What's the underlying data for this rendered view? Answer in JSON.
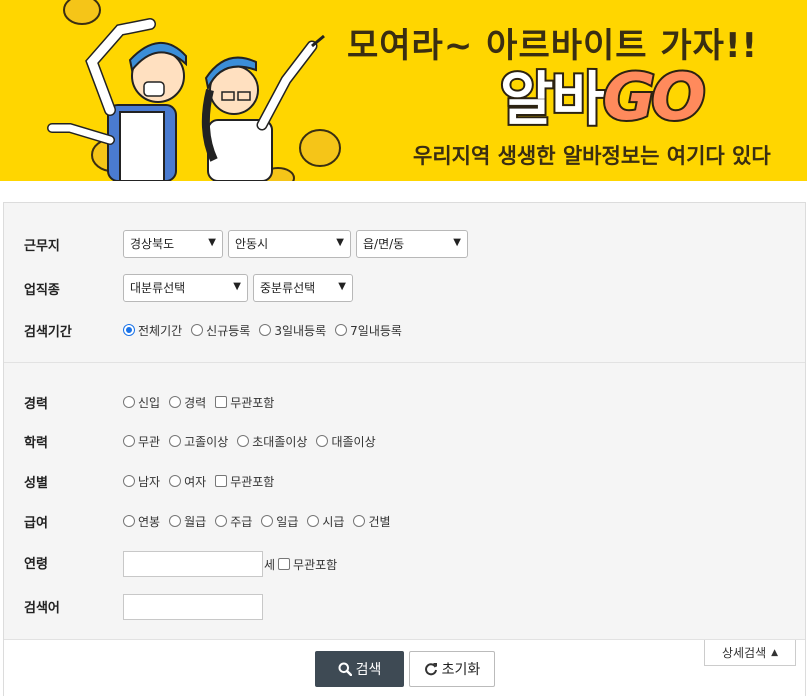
{
  "banner": {
    "title": "모여라~ 아르바이트 가자!!",
    "logo_korean": "알바",
    "logo_go": "GO",
    "subtitle": "우리지역 생생한 알바정보는 여기다 있다"
  },
  "form": {
    "location": {
      "label": "근무지",
      "province": "경상북도",
      "city": "안동시",
      "town": "읍/면/동"
    },
    "job_type": {
      "label": "업직종",
      "major": "대분류선택",
      "minor": "중분류선택"
    },
    "period": {
      "label": "검색기간",
      "options": [
        "전체기간",
        "신규등록",
        "3일내등록",
        "7일내등록"
      ],
      "selected": "전체기간"
    },
    "career": {
      "label": "경력",
      "options": [
        "신입",
        "경력"
      ],
      "any_label": "무관포함"
    },
    "education": {
      "label": "학력",
      "options": [
        "무관",
        "고졸이상",
        "초대졸이상",
        "대졸이상"
      ]
    },
    "gender": {
      "label": "성별",
      "options": [
        "남자",
        "여자"
      ],
      "any_label": "무관포함"
    },
    "pay": {
      "label": "급여",
      "options": [
        "연봉",
        "월급",
        "주급",
        "일급",
        "시급",
        "건별"
      ]
    },
    "age": {
      "label": "연령",
      "value": "",
      "unit": "세",
      "any_label": "무관포함"
    },
    "keyword": {
      "label": "검색어",
      "value": ""
    }
  },
  "buttons": {
    "search": "검색",
    "reset": "초기화",
    "detail": "상세검색"
  },
  "colors": {
    "banner_bg": "#ffd600",
    "search_button": "#3e4a54",
    "radio_selected": "#1a73e8"
  }
}
